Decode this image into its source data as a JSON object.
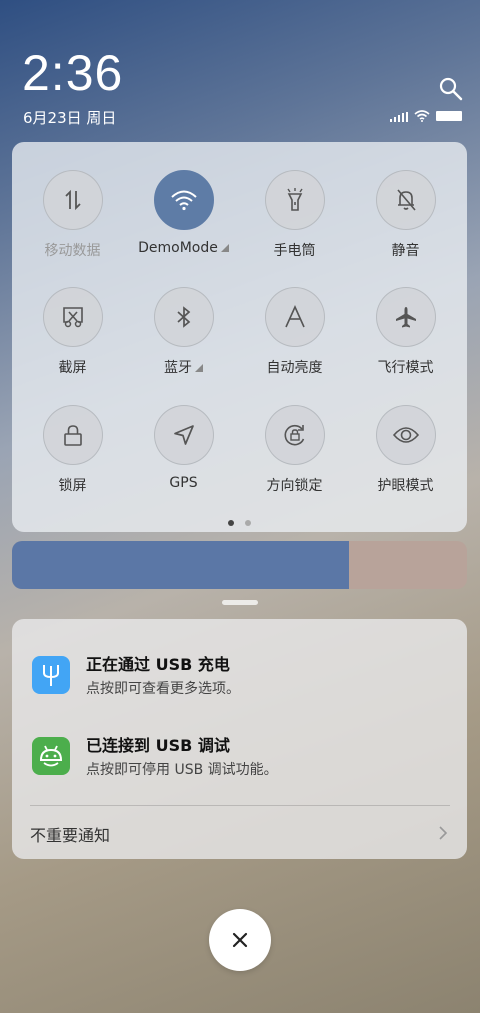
{
  "status": {
    "time": "2:36",
    "date": "6月23日 周日",
    "icons": [
      "search-icon",
      "signal-icon",
      "wifi-icon",
      "battery-icon"
    ]
  },
  "quick_settings": {
    "tiles": [
      {
        "label": "移动数据",
        "icon": "mobile-data-icon",
        "active": false,
        "dim": true
      },
      {
        "label": "DemoMode",
        "icon": "wifi-icon",
        "active": true,
        "expand": true
      },
      {
        "label": "手电筒",
        "icon": "flashlight-icon",
        "active": false
      },
      {
        "label": "静音",
        "icon": "mute-bell-icon",
        "active": false
      },
      {
        "label": "截屏",
        "icon": "screenshot-icon",
        "active": false
      },
      {
        "label": "蓝牙",
        "icon": "bluetooth-icon",
        "active": false,
        "expand": true
      },
      {
        "label": "自动亮度",
        "icon": "auto-brightness-icon",
        "active": false
      },
      {
        "label": "飞行模式",
        "icon": "airplane-icon",
        "active": false
      },
      {
        "label": "锁屏",
        "icon": "lock-icon",
        "active": false
      },
      {
        "label": "GPS",
        "icon": "gps-icon",
        "active": false
      },
      {
        "label": "方向锁定",
        "icon": "rotation-lock-icon",
        "active": false
      },
      {
        "label": "护眼模式",
        "icon": "eye-icon",
        "active": false
      }
    ],
    "page_count": 2,
    "current_page": 1
  },
  "brightness": {
    "level": 0.74
  },
  "notifications": [
    {
      "title": "正在通过  USB  充电",
      "subtitle": "点按即可查看更多选项。",
      "icon": "usb-icon",
      "color": "#42a5f5"
    },
    {
      "title": "已连接到  USB  调试",
      "subtitle": "点按即可停用 USB 调试功能。",
      "icon": "android-icon",
      "color": "#4cae4c"
    }
  ],
  "unimportant_label": "不重要通知",
  "colors": {
    "accent": "#5e7ca6",
    "brightness_fill": "#5b77a6"
  }
}
